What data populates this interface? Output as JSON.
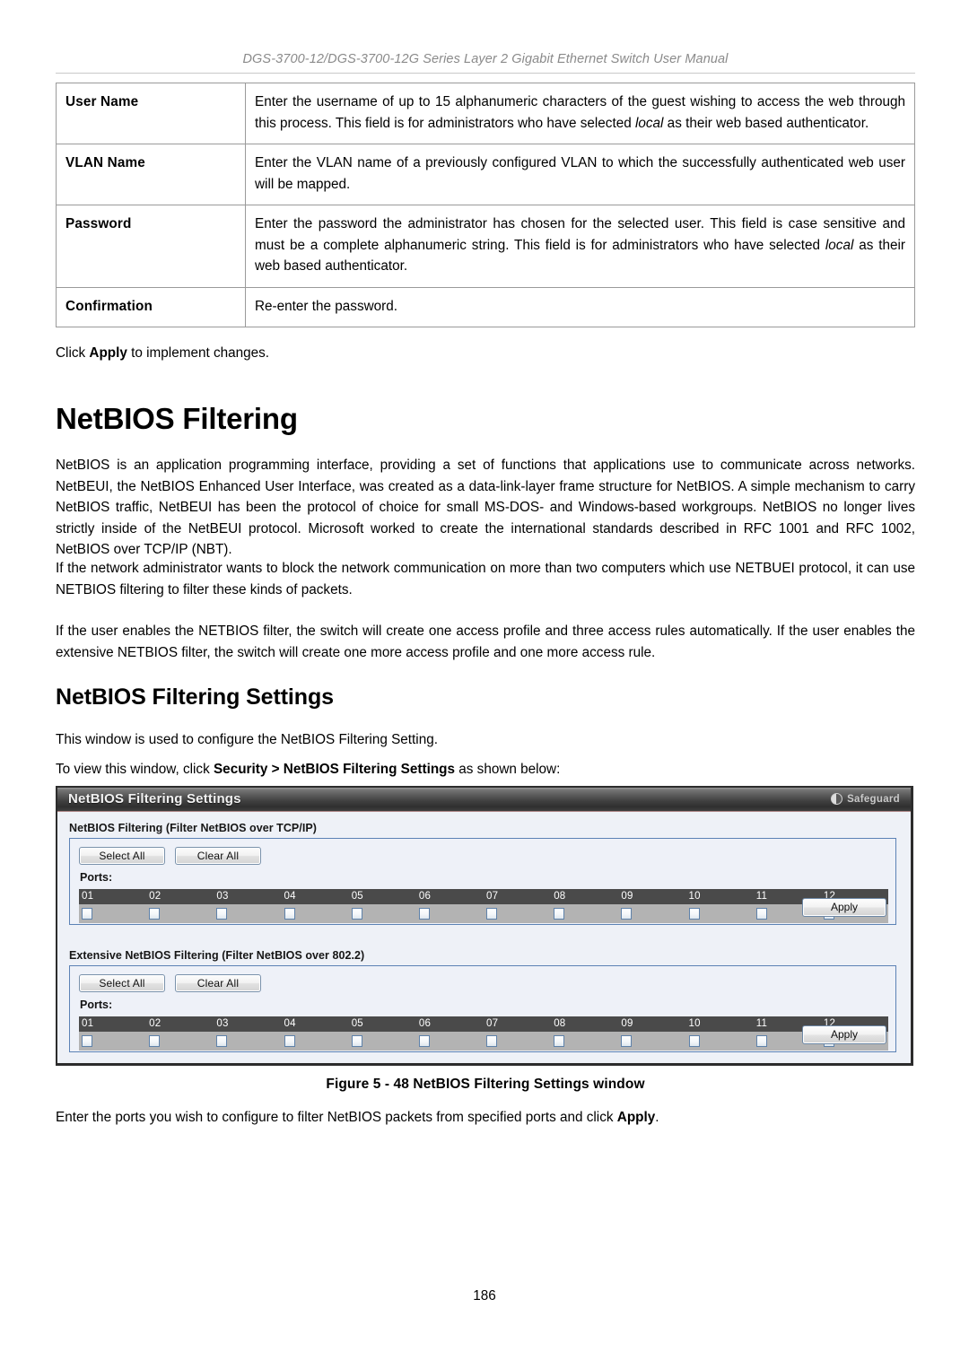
{
  "header": {
    "running_title": "DGS-3700-12/DGS-3700-12G Series Layer 2 Gigabit Ethernet Switch User Manual"
  },
  "param_table": {
    "rows": [
      {
        "name": "User Name",
        "desc_pre": "Enter the username of up to 15 alphanumeric characters of the guest wishing to access the web through this process. This field is for administrators who have selected ",
        "desc_italic": "local",
        "desc_post": " as their web based authenticator."
      },
      {
        "name": "VLAN Name",
        "desc_pre": "Enter the VLAN name of a previously configured VLAN to which the successfully authenticated web user will be mapped.",
        "desc_italic": "",
        "desc_post": ""
      },
      {
        "name": "Password",
        "desc_pre": "Enter the password the administrator has chosen for the selected user. This field is case sensitive and must be a complete alphanumeric string. This field is for administrators who have selected ",
        "desc_italic": "local",
        "desc_post": " as their web based authenticator."
      },
      {
        "name": "Confirmation",
        "desc_pre": "Re-enter the password.",
        "desc_italic": "",
        "desc_post": ""
      }
    ]
  },
  "body": {
    "click_apply_pre": "Click ",
    "click_apply_bold": "Apply",
    "click_apply_post": " to implement changes.",
    "section_title": "NetBIOS Filtering",
    "intro_paragraph": "NetBIOS is an application programming interface, providing a set of functions that applications use to communicate across networks. NetBEUI, the NetBIOS Enhanced User Interface, was created as a data-link-layer frame structure for NetBIOS. A simple mechanism to carry NetBIOS traffic, NetBEUI has been the protocol of choice for small MS-DOS- and Windows-based workgroups. NetBIOS no longer lives strictly inside of the NetBEUI protocol. Microsoft worked to create the international standards described in RFC 1001 and RFC 1002, NetBIOS over TCP/IP (NBT).",
    "block_paragraph": "If the network administrator wants to block the network communication on more than two computers which use NETBUEI protocol, it can use NETBIOS filtering to filter these kinds of packets.",
    "rules_paragraph": "If the user enables the NETBIOS filter, the switch will create one access profile and three access rules automatically. If the user enables the extensive NETBIOS filter, the switch will create one more access profile and one more access rule.",
    "subsection_title": "NetBIOS Filtering Settings",
    "window_purpose": "This window is used to configure the NetBIOS Filtering Setting.",
    "nav_pre": "To view this window, click ",
    "nav_bold": "Security > NetBIOS Filtering Settings",
    "nav_post": " as shown below:",
    "figure_caption": "Figure 5 - 48 NetBIOS Filtering Settings window",
    "closing_pre": "Enter the ports you wish to configure to filter NetBIOS packets from specified ports and click ",
    "closing_bold": "Apply",
    "closing_post": ".",
    "page_number": "186"
  },
  "switch_ui": {
    "window_title": "NetBIOS Filtering Settings",
    "safeguard_label": "Safeguard",
    "safeguard_icon": "safeguard-circle-icon",
    "sections": [
      {
        "label": "NetBIOS Filtering (Filter NetBIOS over TCP/IP)",
        "select_all_label": "Select All",
        "clear_all_label": "Clear All",
        "ports_label": "Ports:",
        "ports": [
          "01",
          "02",
          "03",
          "04",
          "05",
          "06",
          "07",
          "08",
          "09",
          "10",
          "11",
          "12"
        ],
        "checked": [
          false,
          false,
          false,
          false,
          false,
          false,
          false,
          false,
          false,
          false,
          false,
          false
        ],
        "apply_label": "Apply"
      },
      {
        "label": "Extensive NetBIOS Filtering (Filter NetBIOS over 802.2)",
        "select_all_label": "Select All",
        "clear_all_label": "Clear All",
        "ports_label": "Ports:",
        "ports": [
          "01",
          "02",
          "03",
          "04",
          "05",
          "06",
          "07",
          "08",
          "09",
          "10",
          "11",
          "12"
        ],
        "checked": [
          false,
          false,
          false,
          false,
          false,
          false,
          false,
          false,
          false,
          false,
          false,
          false
        ],
        "apply_label": "Apply"
      }
    ]
  },
  "colors": {
    "titlebar_dark": "#3f3f3f",
    "panel_border": "#5c82b5",
    "panel_bg": "#eef1f8",
    "port_header_bg": "#4a4a4a",
    "port_row_bg": "#b3b3b3",
    "checkbox_border": "#5f82aa"
  }
}
